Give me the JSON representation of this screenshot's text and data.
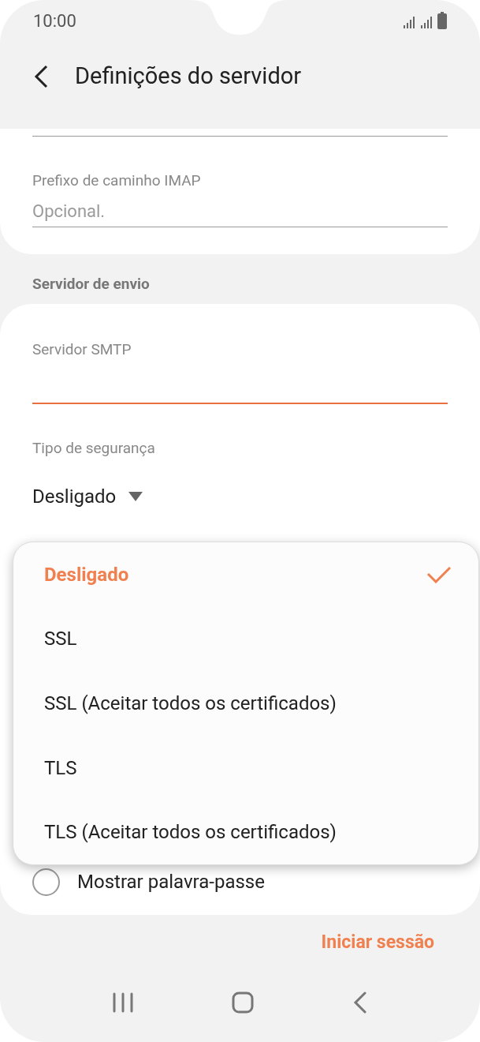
{
  "status_bar": {
    "time": "10:00"
  },
  "header": {
    "title": "Definições do servidor"
  },
  "incoming": {
    "fields": [
      {
        "label": "Prefixo de caminho IMAP",
        "placeholder": "Opcional."
      }
    ]
  },
  "outgoing": {
    "section_title": "Servidor de envio",
    "smtp": {
      "label": "Servidor SMTP",
      "focused": true
    },
    "security": {
      "label": "Tipo de segurança",
      "value": "Desligado"
    },
    "show_password": {
      "label": "Mostrar palavra-passe",
      "checked": false
    }
  },
  "dropdown": {
    "options": [
      {
        "label": "Desligado",
        "selected": true
      },
      {
        "label": "SSL",
        "selected": false
      },
      {
        "label": "SSL (Aceitar todos os certificados)",
        "selected": false
      },
      {
        "label": "TLS",
        "selected": false
      },
      {
        "label": "TLS (Aceitar todos os certificados)",
        "selected": false
      }
    ]
  },
  "sign_in": {
    "label": "Iniciar sessão"
  }
}
